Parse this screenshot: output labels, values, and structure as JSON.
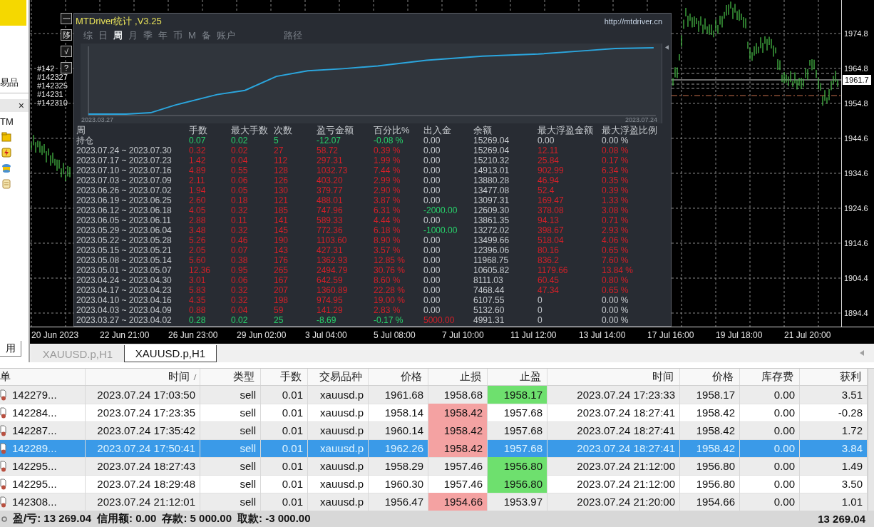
{
  "navigator": {
    "symbols_label": "易品",
    "close": "×",
    "account_label": "TM",
    "bottom_tab": "用"
  },
  "chart_window": {
    "side_buttons": [
      "一",
      "陊",
      "√",
      "?"
    ],
    "order_labels": [
      "#142",
      "#142327",
      "#142325",
      "#14231",
      "#142310"
    ],
    "price_axis": [
      "1974.8",
      "1964.8",
      "1954.8",
      "1944.6",
      "1934.6",
      "1924.6",
      "1914.6",
      "1904.4",
      "1894.4"
    ],
    "current_price": "1961.7",
    "time_axis": [
      "20 Jun 2023",
      "22 Jun 21:00",
      "26 Jun 23:00",
      "29 Jun 02:00",
      "3 Jul 04:00",
      "5 Jul 08:00",
      "7 Jul 10:00",
      "11 Jul 12:00",
      "13 Jul 14:00",
      "17 Jul 16:00",
      "19 Jul 18:00",
      "21 Jul 20:00"
    ]
  },
  "stats_panel": {
    "title": "MTDriver统计 ,V3.25",
    "url": "http://mtdriver.cn",
    "tabs": [
      {
        "label": "综",
        "selected": false
      },
      {
        "label": "日",
        "selected": false
      },
      {
        "label": "周",
        "selected": true
      },
      {
        "label": "月",
        "selected": false
      },
      {
        "label": "季",
        "selected": false
      },
      {
        "label": "年",
        "selected": false
      },
      {
        "label": "币",
        "selected": false
      },
      {
        "label": "M",
        "selected": false
      },
      {
        "label": "备",
        "selected": false
      },
      {
        "label": "账户",
        "selected": false
      }
    ],
    "path_tab": {
      "label": "路径",
      "selected": false
    },
    "equity_chart": {
      "start_date": "2023.03.27",
      "end_date": "2023.07.24"
    },
    "columns": [
      "周",
      "手数",
      "最大手数",
      "次数",
      "盈亏金额",
      "百分比%",
      "出入金",
      "余额",
      "最大浮盈金额",
      "最大浮盈比例"
    ],
    "rows": [
      {
        "period": "持仓",
        "color": "#28d46c",
        "lots": "0.07",
        "max_lots": "0.02",
        "count": "5",
        "pnl": "-12.07",
        "percent": "-0.08 %",
        "deposit": {
          "text": "0.00",
          "color": "#c8ccd0"
        },
        "balance": "15269.04",
        "max_float": {
          "text": "0.00",
          "color": "#c8ccd0"
        },
        "max_float_pct": {
          "text": "0.00 %",
          "color": "#c8ccd0"
        }
      },
      {
        "period": "2023.07.24 ~ 2023.07.30",
        "color": "#d42028",
        "lots": "0.32",
        "max_lots": "0.02",
        "count": "27",
        "pnl": "58.72",
        "percent": "0.39 %",
        "deposit": {
          "text": "0.00",
          "color": "#c8ccd0"
        },
        "balance": "15269.04",
        "max_float": {
          "text": "12.11",
          "color": "#d42028"
        },
        "max_float_pct": {
          "text": "0.08 %",
          "color": "#d42028"
        }
      },
      {
        "period": "2023.07.17 ~ 2023.07.23",
        "color": "#d42028",
        "lots": "1.42",
        "max_lots": "0.04",
        "count": "112",
        "pnl": "297.31",
        "percent": "1.99 %",
        "deposit": {
          "text": "0.00",
          "color": "#c8ccd0"
        },
        "balance": "15210.32",
        "max_float": {
          "text": "25.84",
          "color": "#d42028"
        },
        "max_float_pct": {
          "text": "0.17 %",
          "color": "#d42028"
        }
      },
      {
        "period": "2023.07.10 ~ 2023.07.16",
        "color": "#d42028",
        "lots": "4.89",
        "max_lots": "0.55",
        "count": "128",
        "pnl": "1032.73",
        "percent": "7.44 %",
        "deposit": {
          "text": "0.00",
          "color": "#c8ccd0"
        },
        "balance": "14913.01",
        "max_float": {
          "text": "902.99",
          "color": "#d42028"
        },
        "max_float_pct": {
          "text": "6.34 %",
          "color": "#d42028"
        }
      },
      {
        "period": "2023.07.03 ~ 2023.07.09",
        "color": "#d42028",
        "lots": "2.11",
        "max_lots": "0.06",
        "count": "126",
        "pnl": "403.20",
        "percent": "2.99 %",
        "deposit": {
          "text": "0.00",
          "color": "#c8ccd0"
        },
        "balance": "13880.28",
        "max_float": {
          "text": "46.94",
          "color": "#d42028"
        },
        "max_float_pct": {
          "text": "0.35 %",
          "color": "#d42028"
        }
      },
      {
        "period": "2023.06.26 ~ 2023.07.02",
        "color": "#d42028",
        "lots": "1.94",
        "max_lots": "0.05",
        "count": "130",
        "pnl": "379.77",
        "percent": "2.90 %",
        "deposit": {
          "text": "0.00",
          "color": "#c8ccd0"
        },
        "balance": "13477.08",
        "max_float": {
          "text": "52.4",
          "color": "#d42028"
        },
        "max_float_pct": {
          "text": "0.39 %",
          "color": "#d42028"
        }
      },
      {
        "period": "2023.06.19 ~ 2023.06.25",
        "color": "#d42028",
        "lots": "2.60",
        "max_lots": "0.18",
        "count": "121",
        "pnl": "488.01",
        "percent": "3.87 %",
        "deposit": {
          "text": "0.00",
          "color": "#c8ccd0"
        },
        "balance": "13097.31",
        "max_float": {
          "text": "169.47",
          "color": "#d42028"
        },
        "max_float_pct": {
          "text": "1.33 %",
          "color": "#d42028"
        }
      },
      {
        "period": "2023.06.12 ~ 2023.06.18",
        "color": "#d42028",
        "lots": "4.05",
        "max_lots": "0.32",
        "count": "185",
        "pnl": "747.96",
        "percent": "6.31 %",
        "deposit": {
          "text": "-2000.00",
          "color": "#28d46c"
        },
        "balance": "12609.30",
        "max_float": {
          "text": "378.08",
          "color": "#d42028"
        },
        "max_float_pct": {
          "text": "3.08 %",
          "color": "#d42028"
        }
      },
      {
        "period": "2023.06.05 ~ 2023.06.11",
        "color": "#d42028",
        "lots": "2.88",
        "max_lots": "0.11",
        "count": "141",
        "pnl": "589.33",
        "percent": "4.44 %",
        "deposit": {
          "text": "0.00",
          "color": "#c8ccd0"
        },
        "balance": "13861.35",
        "max_float": {
          "text": "94.13",
          "color": "#d42028"
        },
        "max_float_pct": {
          "text": "0.71 %",
          "color": "#d42028"
        }
      },
      {
        "period": "2023.05.29 ~ 2023.06.04",
        "color": "#d42028",
        "lots": "3.48",
        "max_lots": "0.32",
        "count": "145",
        "pnl": "772.36",
        "percent": "6.18 %",
        "deposit": {
          "text": "-1000.00",
          "color": "#28d46c"
        },
        "balance": "13272.02",
        "max_float": {
          "text": "398.67",
          "color": "#d42028"
        },
        "max_float_pct": {
          "text": "2.93 %",
          "color": "#d42028"
        }
      },
      {
        "period": "2023.05.22 ~ 2023.05.28",
        "color": "#d42028",
        "lots": "5.26",
        "max_lots": "0.46",
        "count": "190",
        "pnl": "1103.60",
        "percent": "8.90 %",
        "deposit": {
          "text": "0.00",
          "color": "#c8ccd0"
        },
        "balance": "13499.66",
        "max_float": {
          "text": "518.04",
          "color": "#d42028"
        },
        "max_float_pct": {
          "text": "4.06 %",
          "color": "#d42028"
        }
      },
      {
        "period": "2023.05.15 ~ 2023.05.21",
        "color": "#d42028",
        "lots": "2.05",
        "max_lots": "0.07",
        "count": "143",
        "pnl": "427.31",
        "percent": "3.57 %",
        "deposit": {
          "text": "0.00",
          "color": "#c8ccd0"
        },
        "balance": "12396.06",
        "max_float": {
          "text": "80.16",
          "color": "#d42028"
        },
        "max_float_pct": {
          "text": "0.65 %",
          "color": "#d42028"
        }
      },
      {
        "period": "2023.05.08 ~ 2023.05.14",
        "color": "#d42028",
        "lots": "5.60",
        "max_lots": "0.38",
        "count": "176",
        "pnl": "1362.93",
        "percent": "12.85 %",
        "deposit": {
          "text": "0.00",
          "color": "#c8ccd0"
        },
        "balance": "11968.75",
        "max_float": {
          "text": "836.2",
          "color": "#d42028"
        },
        "max_float_pct": {
          "text": "7.60 %",
          "color": "#d42028"
        }
      },
      {
        "period": "2023.05.01 ~ 2023.05.07",
        "color": "#d42028",
        "lots": "12.36",
        "max_lots": "0.95",
        "count": "265",
        "pnl": "2494.79",
        "percent": "30.76 %",
        "deposit": {
          "text": "0.00",
          "color": "#c8ccd0"
        },
        "balance": "10605.82",
        "max_float": {
          "text": "1179.66",
          "color": "#d42028"
        },
        "max_float_pct": {
          "text": "13.84 %",
          "color": "#d42028"
        }
      },
      {
        "period": "2023.04.24 ~ 2023.04.30",
        "color": "#d42028",
        "lots": "3.01",
        "max_lots": "0.06",
        "count": "167",
        "pnl": "642.59",
        "percent": "8.60 %",
        "deposit": {
          "text": "0.00",
          "color": "#c8ccd0"
        },
        "balance": "8111.03",
        "max_float": {
          "text": "60.45",
          "color": "#d42028"
        },
        "max_float_pct": {
          "text": "0.80 %",
          "color": "#d42028"
        }
      },
      {
        "period": "2023.04.17 ~ 2023.04.23",
        "color": "#d42028",
        "lots": "5.83",
        "max_lots": "0.32",
        "count": "207",
        "pnl": "1360.89",
        "percent": "22.28 %",
        "deposit": {
          "text": "0.00",
          "color": "#c8ccd0"
        },
        "balance": "7468.44",
        "max_float": {
          "text": "47.34",
          "color": "#d42028"
        },
        "max_float_pct": {
          "text": "0.65 %",
          "color": "#d42028"
        }
      },
      {
        "period": "2023.04.10 ~ 2023.04.16",
        "color": "#d42028",
        "lots": "4.35",
        "max_lots": "0.32",
        "count": "198",
        "pnl": "974.95",
        "percent": "19.00 %",
        "deposit": {
          "text": "0.00",
          "color": "#c8ccd0"
        },
        "balance": "6107.55",
        "max_float": {
          "text": "0",
          "color": "#c8ccd0"
        },
        "max_float_pct": {
          "text": "0.00 %",
          "color": "#c8ccd0"
        }
      },
      {
        "period": "2023.04.03 ~ 2023.04.09",
        "color": "#d42028",
        "lots": "0.88",
        "max_lots": "0.04",
        "count": "59",
        "pnl": "141.29",
        "percent": "2.83 %",
        "deposit": {
          "text": "0.00",
          "color": "#c8ccd0"
        },
        "balance": "5132.60",
        "max_float": {
          "text": "0",
          "color": "#c8ccd0"
        },
        "max_float_pct": {
          "text": "0.00 %",
          "color": "#c8ccd0"
        }
      },
      {
        "period": "2023.03.27 ~ 2023.04.02",
        "color": "#28d46c",
        "lots": "0.28",
        "max_lots": "0.02",
        "count": "25",
        "pnl": "-8.69",
        "percent": "-0.17 %",
        "deposit": {
          "text": "5000.00",
          "color": "#d42028"
        },
        "balance": "4991.31",
        "max_float": {
          "text": "0",
          "color": "#c8ccd0"
        },
        "max_float_pct": {
          "text": "0.00 %",
          "color": "#c8ccd0"
        }
      }
    ]
  },
  "chart_tabs": [
    {
      "label": "XAUUSD.p,H1",
      "selected": false
    },
    {
      "label": "XAUUSD.p,H1",
      "selected": true
    }
  ],
  "terminal": {
    "columns": [
      {
        "label": "单",
        "sorted": false
      },
      {
        "label": "时间",
        "sorted": true
      },
      {
        "label": "类型",
        "sorted": false
      },
      {
        "label": "手数",
        "sorted": false
      },
      {
        "label": "交易品种",
        "sorted": false
      },
      {
        "label": "价格",
        "sorted": false
      },
      {
        "label": "止损",
        "sorted": false
      },
      {
        "label": "止盈",
        "sorted": false
      },
      {
        "label": "时间",
        "sorted": false
      },
      {
        "label": "价格",
        "sorted": false
      },
      {
        "label": "库存费",
        "sorted": false
      },
      {
        "label": "获利",
        "sorted": false
      }
    ],
    "rows": [
      {
        "order": "142279...",
        "open_time": "2023.07.24 17:03:50",
        "type": "sell",
        "lots": "0.01",
        "symbol": "xauusd.p",
        "open_price": "1961.68",
        "sl": "1958.68",
        "tp": "1958.17",
        "close_time": "2023.07.24 17:23:33",
        "close_price": "1958.17",
        "swap": "0.00",
        "profit": "3.51",
        "sl_hit": false,
        "tp_hit": true,
        "selected": false
      },
      {
        "order": "142284...",
        "open_time": "2023.07.24 17:23:35",
        "type": "sell",
        "lots": "0.01",
        "symbol": "xauusd.p",
        "open_price": "1958.14",
        "sl": "1958.42",
        "tp": "1957.68",
        "close_time": "2023.07.24 18:27:41",
        "close_price": "1958.42",
        "swap": "0.00",
        "profit": "-0.28",
        "sl_hit": true,
        "tp_hit": false,
        "selected": false
      },
      {
        "order": "142287...",
        "open_time": "2023.07.24 17:35:42",
        "type": "sell",
        "lots": "0.01",
        "symbol": "xauusd.p",
        "open_price": "1960.14",
        "sl": "1958.42",
        "tp": "1957.68",
        "close_time": "2023.07.24 18:27:41",
        "close_price": "1958.42",
        "swap": "0.00",
        "profit": "1.72",
        "sl_hit": true,
        "tp_hit": false,
        "selected": false
      },
      {
        "order": "142289...",
        "open_time": "2023.07.24 17:50:41",
        "type": "sell",
        "lots": "0.01",
        "symbol": "xauusd.p",
        "open_price": "1962.26",
        "sl": "1958.42",
        "tp": "1957.68",
        "close_time": "2023.07.24 18:27:41",
        "close_price": "1958.42",
        "swap": "0.00",
        "profit": "3.84",
        "sl_hit": true,
        "tp_hit": false,
        "selected": true
      },
      {
        "order": "142295...",
        "open_time": "2023.07.24 18:27:43",
        "type": "sell",
        "lots": "0.01",
        "symbol": "xauusd.p",
        "open_price": "1958.29",
        "sl": "1957.46",
        "tp": "1956.80",
        "close_time": "2023.07.24 21:12:00",
        "close_price": "1956.80",
        "swap": "0.00",
        "profit": "1.49",
        "sl_hit": false,
        "tp_hit": true,
        "selected": false
      },
      {
        "order": "142295...",
        "open_time": "2023.07.24 18:29:48",
        "type": "sell",
        "lots": "0.01",
        "symbol": "xauusd.p",
        "open_price": "1960.30",
        "sl": "1957.46",
        "tp": "1956.80",
        "close_time": "2023.07.24 21:12:00",
        "close_price": "1956.80",
        "swap": "0.00",
        "profit": "3.50",
        "sl_hit": false,
        "tp_hit": true,
        "selected": false
      },
      {
        "order": "142308...",
        "open_time": "2023.07.24 21:12:01",
        "type": "sell",
        "lots": "0.01",
        "symbol": "xauusd.p",
        "open_price": "1956.47",
        "sl": "1954.66",
        "tp": "1953.97",
        "close_time": "2023.07.24 21:20:00",
        "close_price": "1954.66",
        "swap": "0.00",
        "profit": "1.01",
        "sl_hit": true,
        "tp_hit": false,
        "selected": false
      }
    ],
    "status": {
      "items": [
        "盈/亏: 13 269.04",
        "信用额: 0.00",
        "存款: 5 000.00",
        "取款: -3 000.00"
      ],
      "total": "13 269.04"
    }
  }
}
